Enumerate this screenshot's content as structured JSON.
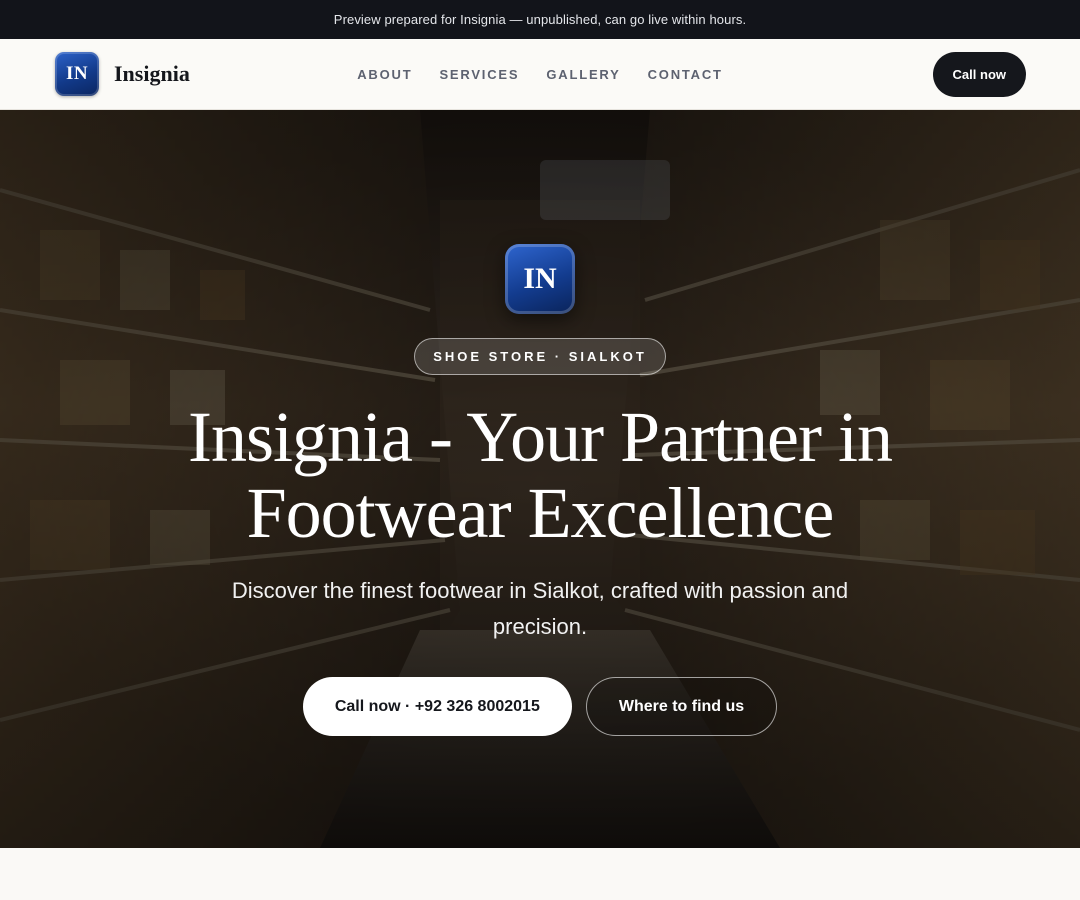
{
  "preview_bar": {
    "text": "Preview prepared for Insignia — unpublished, can go live within hours."
  },
  "brand": {
    "logo_text": "IN",
    "name": "Insignia",
    "logo_color": "#1a4aa8"
  },
  "nav": {
    "links": [
      "ABOUT",
      "SERVICES",
      "GALLERY",
      "CONTACT"
    ],
    "cta_label": "Call now"
  },
  "hero": {
    "logo_text": "IN",
    "badge": "SHOE STORE · SIALKOT",
    "title": "Insignia - Your Partner in Footwear Excellence",
    "subtitle": "Discover the finest footwear in Sialkot, crafted with passion and precision.",
    "primary_button": "Call now · +92 326 8002015",
    "secondary_button": "Where to find us",
    "background": "store-aisle-shelves-photo"
  },
  "colors": {
    "dark": "#15171c",
    "nav_link": "#5d6270",
    "page_bg": "#faf9f6"
  }
}
